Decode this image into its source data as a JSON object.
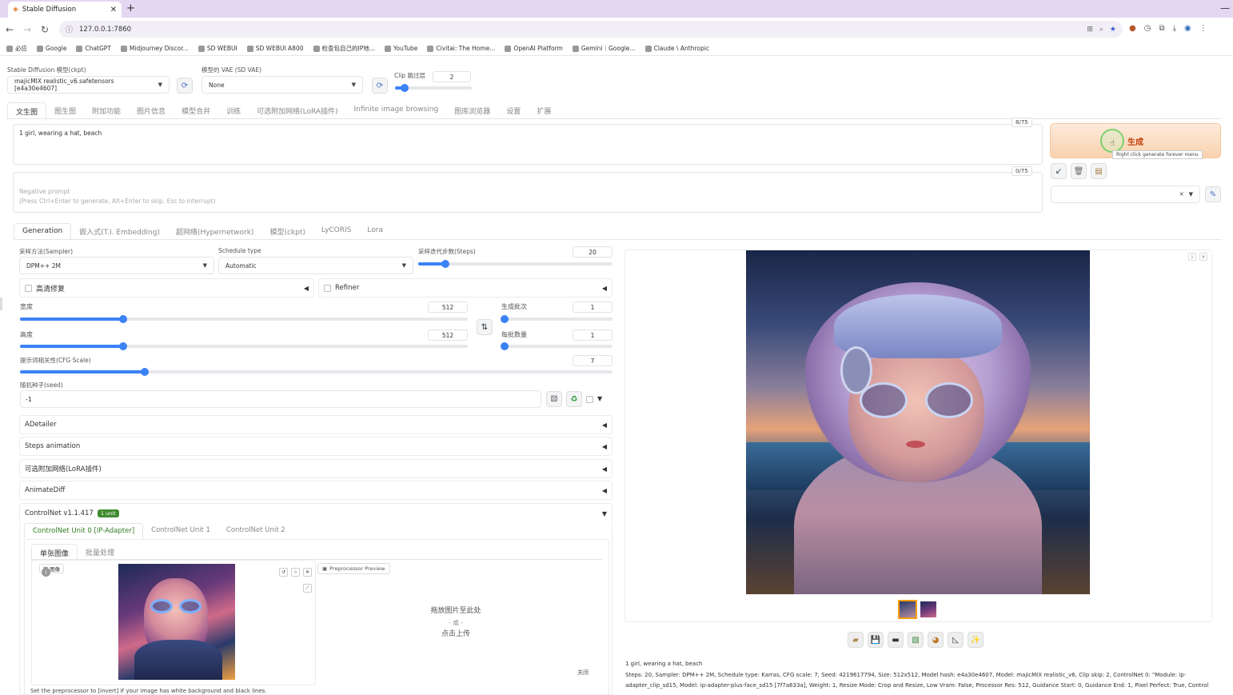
{
  "browser": {
    "tab_title": "Stable Diffusion",
    "url": "127.0.0.1:7860",
    "bookmarks": [
      "必应",
      "Google",
      "ChatGPT",
      "Midjourney Discor...",
      "SD WEBUI",
      "SD WEBUI A800",
      "检查包自己的IP地...",
      "YouTube",
      "Civitai: The Home...",
      "OpenAI Platform",
      "Gemini｜Google...",
      "Claude \\ Anthropic"
    ]
  },
  "top": {
    "ckpt_label": "Stable Diffusion 模型(ckpt)",
    "ckpt_value": "majicMIX realistic_v6.safetensors [e4a30e4607]",
    "vae_label": "模型的 VAE (SD VAE)",
    "vae_value": "None",
    "clip_label": "Clip 跳过层",
    "clip_value": "2",
    "clip_fraction": 0.12
  },
  "main_tabs": [
    "文生图",
    "图生图",
    "附加功能",
    "图片信息",
    "模型合并",
    "训练",
    "可选附加网络(LoRA插件)",
    "Infinite image browsing",
    "图库浏览器",
    "设置",
    "扩展"
  ],
  "prompt": {
    "text": "1 girl, wearing a hat,  beach",
    "counter": "8/75",
    "neg_placeholder": "Negative prompt\n(Press Ctrl+Enter to generate, Alt+Enter to skip, Esc to interrupt)",
    "neg_counter": "0/75"
  },
  "generate": {
    "label": "生成",
    "tooltip": "Right click generate forever menu"
  },
  "sub_tabs": [
    "Generation",
    "嵌入式(T.I. Embedding)",
    "超网络(Hypernetwork)",
    "模型(ckpt)",
    "LyCORIS",
    "Lora"
  ],
  "params": {
    "sampler_label": "采样方法(Sampler)",
    "sampler_value": "DPM++ 2M",
    "schedule_label": "Schedule type",
    "schedule_value": "Automatic",
    "steps_label": "采样迭代步数(Steps)",
    "steps_value": "20",
    "steps_fraction": 0.14,
    "hires_label": "高清修复",
    "refiner_label": "Refiner",
    "width_label": "宽度",
    "width_value": "512",
    "width_fraction": 0.23,
    "height_label": "高度",
    "height_value": "512",
    "height_fraction": 0.23,
    "batch_count_label": "生成批次",
    "batch_count_value": "1",
    "batch_count_fraction": 0.0,
    "batch_size_label": "每批数量",
    "batch_size_value": "1",
    "batch_size_fraction": 0.0,
    "cfg_label": "提示词相关性(CFG Scale)",
    "cfg_value": "7",
    "cfg_fraction": 0.21,
    "seed_label": "随机种子(seed)",
    "seed_value": "-1"
  },
  "accordions": [
    "ADetailer",
    "Steps animation",
    "可选附加网络(LoRA插件)",
    "AnimateDiff"
  ],
  "controlnet": {
    "title": "ControlNet v1.1.417",
    "badge": "1 unit",
    "units": [
      "ControlNet Unit 0 [IP-Adapter]",
      "ControlNet Unit 1",
      "ControlNet Unit 2"
    ],
    "mode_tabs": [
      "单张图像",
      "批量处理"
    ],
    "image_label": "图像",
    "preview_label": "Preprocessor Preview",
    "drop_line1": "拖放图片至此处",
    "drop_or": "- 或 -",
    "drop_line2": "点击上传",
    "close_label": "关闭",
    "hint": "Set the preprocessor to [invert] If your image has white background and black lines."
  },
  "output": {
    "caption_line1": "1 girl, wearing a hat, beach",
    "caption_line2": "Steps: 20, Sampler: DPM++ 2M, Schedule type: Karras, CFG scale: 7, Seed: 4219617794, Size: 512x512, Model hash: e4a30e4607, Model: majicMIX realistic_v6, Clip skip: 2, ControlNet 0: \"Module: ip-",
    "caption_line3": "adapter_clip_sd15, Model: ip-adapter-plus-face_sd15 [7f7a633a], Weight: 1, Resize Mode: Crop and Resize, Low Vram: False, Processor Res: 512, Guidance Start: 0, Guidance End: 1, Pixel Perfect: True, Control"
  },
  "colors": {
    "accent": "#3b82f6",
    "generate_bg": "#fbe3cc",
    "generate_text": "#c2410c",
    "badge_bg": "#3f8b2e",
    "active_unit": "#2f7d1f"
  }
}
